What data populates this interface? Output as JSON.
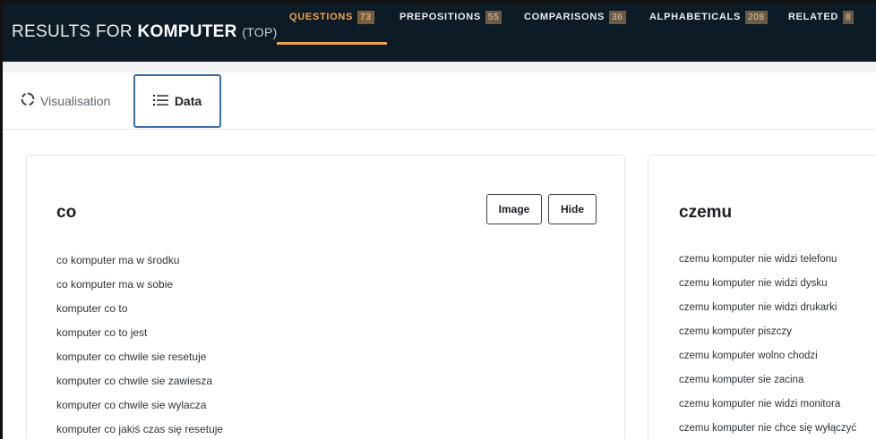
{
  "header": {
    "title_prefix": "RESULTS FOR ",
    "keyword": "KOMPUTER",
    "title_suffix": "(TOP)",
    "tabs": [
      {
        "label": "QUESTIONS",
        "count": "73"
      },
      {
        "label": "PREPOSITIONS",
        "count": "55"
      },
      {
        "label": "COMPARISONS",
        "count": "36"
      },
      {
        "label": "ALPHABETICALS",
        "count": "208"
      },
      {
        "label": "RELATED",
        "count": "8"
      }
    ],
    "active_tab_color": "#f0a24a",
    "background_color": "#0d1b26"
  },
  "view_toggle": {
    "visualisation_label": "Visualisation",
    "data_label": "Data",
    "selected": "Data"
  },
  "cards": [
    {
      "title": "co",
      "image_button": "Image",
      "hide_button": "Hide",
      "items": [
        "co komputer ma w środku",
        "co komputer ma w sobie",
        "komputer co to",
        "komputer co to jest",
        "komputer co chwile sie resetuje",
        "komputer co chwile sie zawiesza",
        "komputer co chwile sie wylacza",
        "komputer co jakiś czas się resetuje"
      ]
    },
    {
      "title": "czemu",
      "items": [
        "czemu komputer nie widzi telefonu",
        "czemu komputer nie widzi dysku",
        "czemu komputer nie widzi drukarki",
        "czemu komputer piszczy",
        "czemu komputer wolno chodzi",
        "czemu komputer sie zacina",
        "czemu komputer nie widzi monitora",
        "czemu komputer nie chce się wyłączyć"
      ]
    }
  ]
}
